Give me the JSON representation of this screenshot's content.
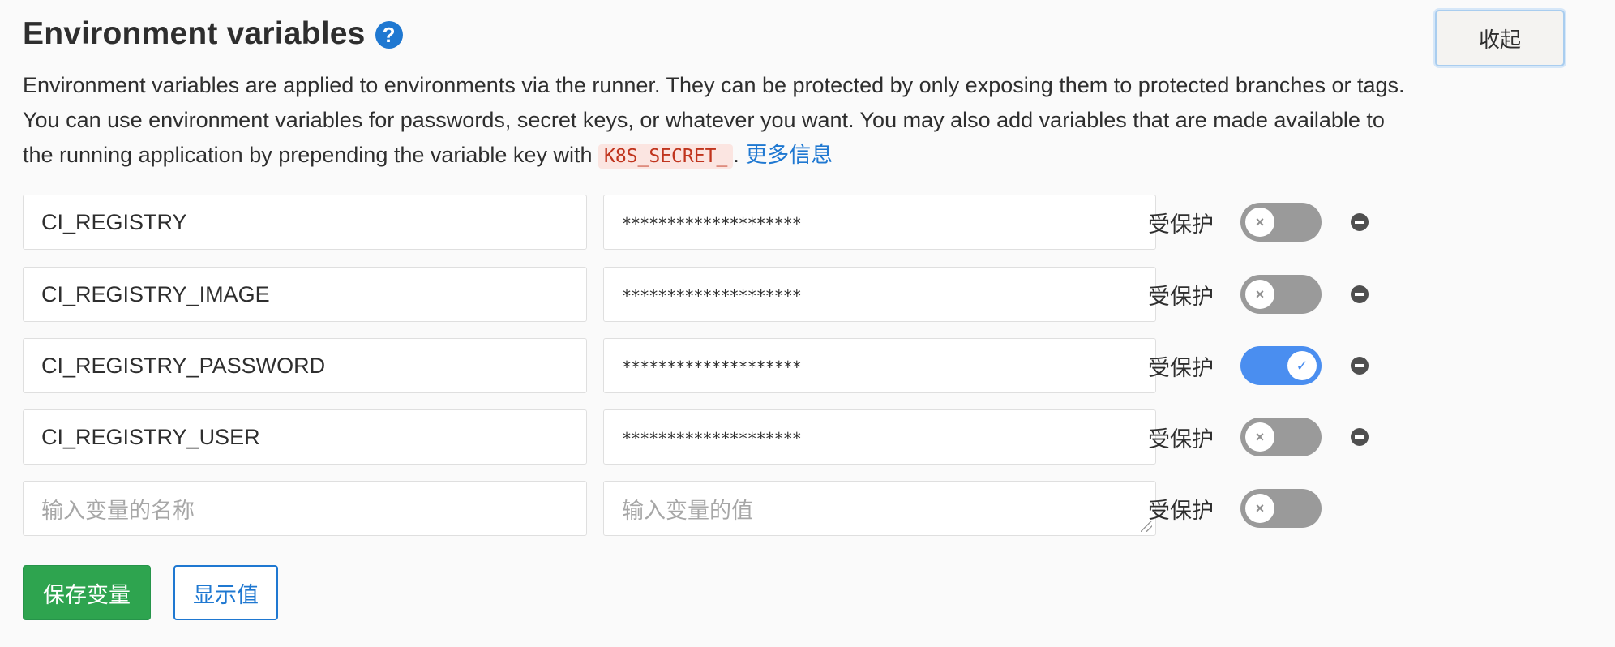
{
  "header": {
    "title": "Environment variables",
    "help_icon": "?",
    "collapse_label": "收起"
  },
  "description": {
    "text_before": "Environment variables are applied to environments via the runner. They can be protected by only exposing them to protected branches or tags. You can use environment variables for passwords, secret keys, or whatever you want. You may also add variables that are made available to the running application by prepending the variable key with ",
    "code": "K8S_SECRET_",
    "text_after": ". ",
    "link": "更多信息"
  },
  "variables": [
    {
      "key": "CI_REGISTRY",
      "value": "********************",
      "protected_label": "受保护",
      "protected": false,
      "toggle_icon": "×"
    },
    {
      "key": "CI_REGISTRY_IMAGE",
      "value": "********************",
      "protected_label": "受保护",
      "protected": false,
      "toggle_icon": "×"
    },
    {
      "key": "CI_REGISTRY_PASSWORD",
      "value": "********************",
      "protected_label": "受保护",
      "protected": true,
      "toggle_icon": "✓"
    },
    {
      "key": "CI_REGISTRY_USER",
      "value": "********************",
      "protected_label": "受保护",
      "protected": false,
      "toggle_icon": "×"
    }
  ],
  "new_variable": {
    "key_placeholder": "输入变量的名称",
    "value_placeholder": "输入变量的值",
    "protected_label": "受保护",
    "protected": false,
    "toggle_icon": "×"
  },
  "actions": {
    "save_label": "保存变量",
    "reveal_label": "显示值"
  },
  "colors": {
    "primary": "#1f78d1",
    "save_green": "#2ea44f",
    "toggle_on": "#4a8ef0",
    "toggle_off": "#9a9a9a"
  }
}
